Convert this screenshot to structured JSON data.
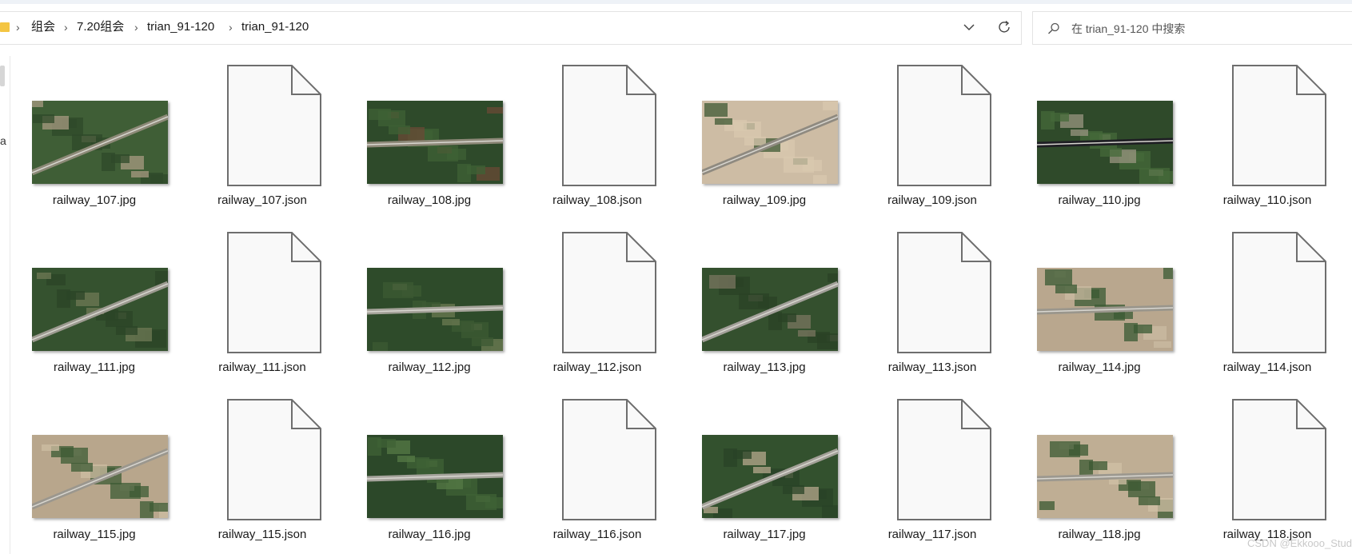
{
  "breadcrumb": {
    "items": [
      "组会",
      "7.20组会",
      "trian_91-120",
      "trian_91-120"
    ],
    "separator": "›"
  },
  "search": {
    "placeholder": "在 trian_91-120 中搜索"
  },
  "sidebar": {
    "partial_label": "a"
  },
  "files": [
    {
      "name": "railway_107.jpg",
      "kind": "image",
      "palette": [
        "#3f5e36",
        "#2f4a2a",
        "#8d8a78",
        "#a89b82"
      ]
    },
    {
      "name": "railway_107.json",
      "kind": "doc"
    },
    {
      "name": "railway_108.jpg",
      "kind": "image",
      "palette": [
        "#2e4a2a",
        "#3f6236",
        "#8f8a7a",
        "#6a4a35"
      ]
    },
    {
      "name": "railway_108.json",
      "kind": "doc"
    },
    {
      "name": "railway_109.jpg",
      "kind": "image",
      "palette": [
        "#cdbca4",
        "#d8c8af",
        "#8f8a80",
        "#3f5a34"
      ]
    },
    {
      "name": "railway_109.json",
      "kind": "doc"
    },
    {
      "name": "railway_110.jpg",
      "kind": "image",
      "palette": [
        "#2f4a2a",
        "#456a3a",
        "#1f1f24",
        "#9a9580"
      ]
    },
    {
      "name": "railway_110.json",
      "kind": "doc"
    },
    {
      "name": "railway_111.jpg",
      "kind": "image",
      "palette": [
        "#35522f",
        "#2b4427",
        "#9c9a90",
        "#6f7a55"
      ]
    },
    {
      "name": "railway_111.json",
      "kind": "doc"
    },
    {
      "name": "railway_112.jpg",
      "kind": "image",
      "palette": [
        "#2e4b2a",
        "#3c5a33",
        "#a5a39a",
        "#6b7a52"
      ]
    },
    {
      "name": "railway_112.json",
      "kind": "doc"
    },
    {
      "name": "railway_113.jpg",
      "kind": "image",
      "palette": [
        "#34502e",
        "#2a4226",
        "#a3a09a",
        "#7a7560"
      ]
    },
    {
      "name": "railway_113.json",
      "kind": "doc"
    },
    {
      "name": "railway_114.jpg",
      "kind": "image",
      "palette": [
        "#b9a78e",
        "#3a5a33",
        "#9a968c",
        "#cbbba2"
      ]
    },
    {
      "name": "railway_114.json",
      "kind": "doc"
    },
    {
      "name": "railway_115.jpg",
      "kind": "image",
      "palette": [
        "#b8a68c",
        "#3c5b34",
        "#9b978e",
        "#cdbda3"
      ]
    },
    {
      "name": "railway_115.json",
      "kind": "doc"
    },
    {
      "name": "railway_116.jpg",
      "kind": "image",
      "palette": [
        "#2c4829",
        "#3f6236",
        "#a6a49c",
        "#557a45"
      ]
    },
    {
      "name": "railway_116.json",
      "kind": "doc"
    },
    {
      "name": "railway_117.jpg",
      "kind": "image",
      "palette": [
        "#33512e",
        "#2a4327",
        "#a3a098",
        "#b7a88e"
      ]
    },
    {
      "name": "railway_117.json",
      "kind": "doc"
    },
    {
      "name": "railway_118.jpg",
      "kind": "image",
      "palette": [
        "#bfae94",
        "#3a5832",
        "#9c988f",
        "#d0c0a6"
      ]
    },
    {
      "name": "railway_118.json",
      "kind": "doc"
    }
  ],
  "watermark": "CSDN @Ekkooo_Studio",
  "colors": {
    "folder": "#f4c542",
    "border": "#e3e3e3",
    "doc_stroke": "#6e6e6e",
    "doc_fill": "#f9f9f9"
  }
}
